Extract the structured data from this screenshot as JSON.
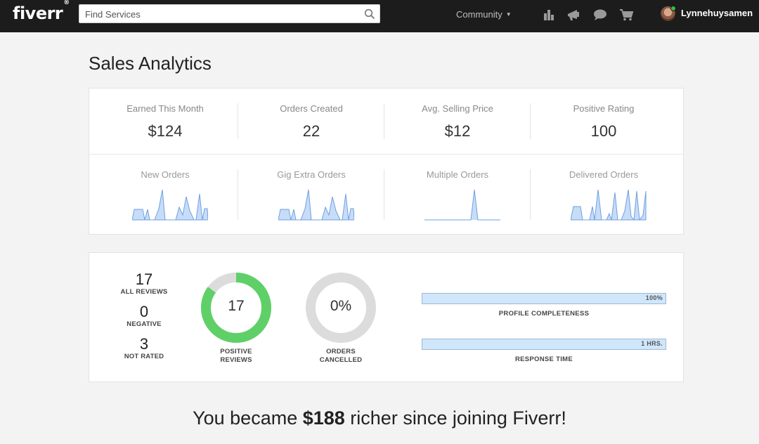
{
  "header": {
    "logo_text": "fiverr",
    "logo_mark": "®",
    "search_placeholder": "Find Services",
    "community_label": "Community",
    "username": "Lynnehuysamen",
    "icons": [
      "analytics-icon",
      "megaphone-icon",
      "chat-icon",
      "cart-icon"
    ]
  },
  "page": {
    "title": "Sales Analytics"
  },
  "stats": [
    {
      "label": "Earned This Month",
      "value": "$124"
    },
    {
      "label": "Orders Created",
      "value": "22"
    },
    {
      "label": "Avg. Selling Price",
      "value": "$12"
    },
    {
      "label": "Positive Rating",
      "value": "100"
    }
  ],
  "sparklines": [
    {
      "label": "New Orders"
    },
    {
      "label": "Gig Extra Orders"
    },
    {
      "label": "Multiple Orders"
    },
    {
      "label": "Delivered Orders"
    }
  ],
  "reviews": {
    "all": {
      "value": "17",
      "label": "ALL REVIEWS"
    },
    "negative": {
      "value": "0",
      "label": "NEGATIVE"
    },
    "not_rated": {
      "value": "3",
      "label": "NOT RATED"
    },
    "positive_donut": {
      "value": "17",
      "label_line1": "POSITIVE",
      "label_line2": "REVIEWS",
      "fraction": 0.85
    },
    "cancelled_donut": {
      "value": "0%",
      "label_line1": "ORDERS",
      "label_line2": "CANCELLED",
      "fraction": 0
    }
  },
  "progress": [
    {
      "label": "PROFILE COMPLETENESS",
      "value": "100%",
      "fraction": 1.0
    },
    {
      "label": "RESPONSE TIME",
      "value": "1 HRS.",
      "fraction": 1.0
    }
  ],
  "footer": {
    "prefix": "You became ",
    "amount": "$188",
    "suffix": " richer since joining Fiverr!"
  },
  "colors": {
    "topbar": "#1c1c1c",
    "donut_green": "#5fd068",
    "donut_gray": "#dcdcdc",
    "spark_fill": "#c7dcf7",
    "spark_line": "#6fa0e0",
    "bar_fill": "#cfe6fb"
  }
}
